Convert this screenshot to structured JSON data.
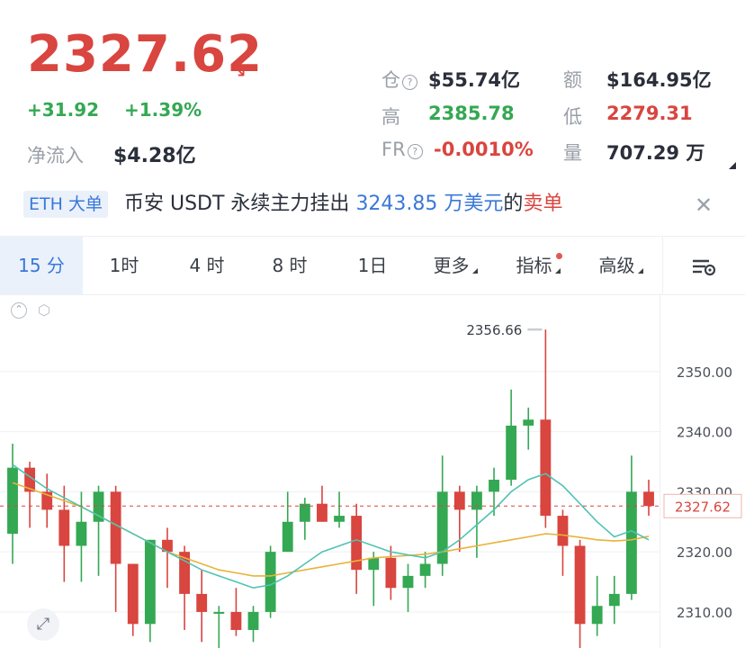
{
  "ticker": {
    "price": "2327.62",
    "change_abs": "+31.92",
    "change_pct": "+1.39%",
    "netflow_label": "净流入",
    "netflow_value": "$4.28亿"
  },
  "stats": {
    "oi_label": "仓",
    "oi_value": "$55.74亿",
    "turnover_label": "额",
    "turnover_value": "$164.95亿",
    "high_label": "高",
    "high_value": "2385.78",
    "low_label": "低",
    "low_value": "2279.31",
    "fr_label": "FR",
    "fr_value": "-0.0010%",
    "vol_label": "量",
    "vol_value": "707.29 万"
  },
  "news": {
    "tag": "ETH 大单",
    "text_pre": "币安 USDT 永续主力挂出 ",
    "amount": "3243.85 万美元",
    "text_mid": "的",
    "side": "卖单"
  },
  "tabs": {
    "t15m": "15 分",
    "t1h": "1时",
    "t4h": "4 时",
    "t8h": "8 时",
    "t1d": "1日",
    "more": "更多",
    "indicators": "指标",
    "advanced": "高级"
  },
  "colors": {
    "up": "#34a853",
    "down": "#d9453f",
    "ma_fast": "#4fc3b3",
    "ma_slow": "#e8b33a",
    "accent": "#3a78d8"
  },
  "chart_data": {
    "type": "candlestick",
    "ylim": [
      2304,
      2363
    ],
    "y_ticks": [
      "2350.00",
      "2340.00",
      "2330.00",
      "2320.00",
      "2310.00"
    ],
    "current_price": "2327.62",
    "max_label": "2356.66",
    "candles": [
      {
        "o": 2323,
        "c": 2334,
        "h": 2338,
        "l": 2318
      },
      {
        "o": 2334,
        "c": 2330,
        "h": 2335,
        "l": 2324
      },
      {
        "o": 2330,
        "c": 2327,
        "h": 2333,
        "l": 2324
      },
      {
        "o": 2327,
        "c": 2321,
        "h": 2331,
        "l": 2315
      },
      {
        "o": 2321,
        "c": 2325,
        "h": 2330,
        "l": 2315
      },
      {
        "o": 2325,
        "c": 2330,
        "h": 2331,
        "l": 2316
      },
      {
        "o": 2330,
        "c": 2318,
        "h": 2331,
        "l": 2310
      },
      {
        "o": 2318,
        "c": 2308,
        "h": 2318,
        "l": 2306
      },
      {
        "o": 2308,
        "c": 2322,
        "h": 2322,
        "l": 2305
      },
      {
        "o": 2322,
        "c": 2320,
        "h": 2324,
        "l": 2314
      },
      {
        "o": 2320,
        "c": 2313,
        "h": 2321,
        "l": 2307
      },
      {
        "o": 2313,
        "c": 2310,
        "h": 2317,
        "l": 2305
      },
      {
        "o": 2310,
        "c": 2310,
        "h": 2311,
        "l": 2303
      },
      {
        "o": 2310,
        "c": 2307,
        "h": 2314,
        "l": 2306
      },
      {
        "o": 2307,
        "c": 2310,
        "h": 2311,
        "l": 2305
      },
      {
        "o": 2310,
        "c": 2320,
        "h": 2321,
        "l": 2309
      },
      {
        "o": 2320,
        "c": 2325,
        "h": 2330,
        "l": 2320
      },
      {
        "o": 2325,
        "c": 2328,
        "h": 2329,
        "l": 2322
      },
      {
        "o": 2328,
        "c": 2325,
        "h": 2331,
        "l": 2325
      },
      {
        "o": 2325,
        "c": 2326,
        "h": 2330,
        "l": 2324
      },
      {
        "o": 2326,
        "c": 2317,
        "h": 2328,
        "l": 2313
      },
      {
        "o": 2317,
        "c": 2319,
        "h": 2320,
        "l": 2311
      },
      {
        "o": 2319,
        "c": 2314,
        "h": 2321,
        "l": 2312
      },
      {
        "o": 2314,
        "c": 2316,
        "h": 2318,
        "l": 2310
      },
      {
        "o": 2316,
        "c": 2318,
        "h": 2320,
        "l": 2314
      },
      {
        "o": 2318,
        "c": 2330,
        "h": 2336,
        "l": 2316
      },
      {
        "o": 2330,
        "c": 2327,
        "h": 2331,
        "l": 2320
      },
      {
        "o": 2327,
        "c": 2330,
        "h": 2331,
        "l": 2319
      },
      {
        "o": 2330,
        "c": 2332,
        "h": 2334,
        "l": 2326
      },
      {
        "o": 2332,
        "c": 2341,
        "h": 2347,
        "l": 2331
      },
      {
        "o": 2341,
        "c": 2342,
        "h": 2344,
        "l": 2337
      },
      {
        "o": 2342,
        "c": 2326,
        "h": 2357,
        "l": 2324
      },
      {
        "o": 2326,
        "c": 2321,
        "h": 2327,
        "l": 2316
      },
      {
        "o": 2321,
        "c": 2308,
        "h": 2322,
        "l": 2304
      },
      {
        "o": 2308,
        "c": 2311,
        "h": 2316,
        "l": 2306
      },
      {
        "o": 2311,
        "c": 2313,
        "h": 2316,
        "l": 2308
      },
      {
        "o": 2313,
        "c": 2330,
        "h": 2336,
        "l": 2312
      },
      {
        "o": 2330,
        "c": 2327.62,
        "h": 2332,
        "l": 2326
      }
    ],
    "ma_fast": [
      2334.5,
      2332.5,
      2330.5,
      2329,
      2327.5,
      2326,
      2324.5,
      2323,
      2321.5,
      2320,
      2318.5,
      2317,
      2316,
      2315,
      2314,
      2314.5,
      2316,
      2318,
      2320,
      2321,
      2322,
      2321,
      2320,
      2319.5,
      2319,
      2320,
      2322,
      2324.5,
      2327,
      2330,
      2332,
      2333,
      2331,
      2328,
      2325,
      2322.5,
      2323.5,
      2322
    ],
    "ma_slow": [
      2331.5,
      2330.5,
      2329.5,
      2328.5,
      2327.5,
      2326,
      2324.5,
      2323,
      2321.5,
      2320,
      2319,
      2318,
      2317,
      2316.5,
      2316,
      2316,
      2316.5,
      2317,
      2317.5,
      2318,
      2318.5,
      2319,
      2319.2,
      2319.4,
      2319.6,
      2320,
      2320.5,
      2321,
      2321.5,
      2322,
      2322.5,
      2323,
      2322.8,
      2322.4,
      2322,
      2321.8,
      2322,
      2322.6
    ]
  }
}
